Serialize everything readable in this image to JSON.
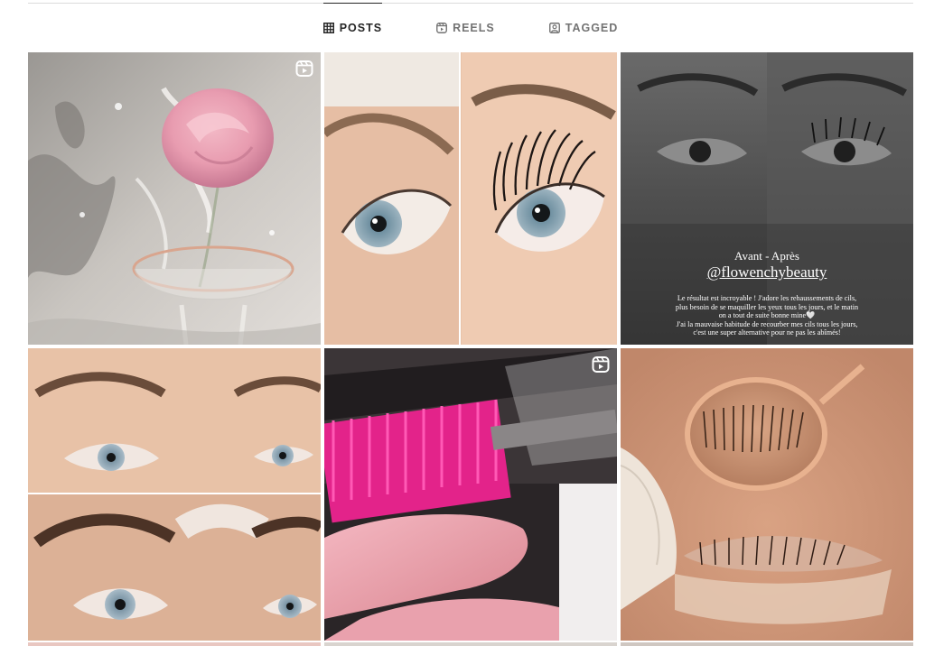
{
  "tabs": [
    {
      "label": "POSTS",
      "icon": "grid-icon",
      "active": true
    },
    {
      "label": "REELS",
      "icon": "reels-icon",
      "active": false
    },
    {
      "label": "TAGGED",
      "icon": "tagged-icon",
      "active": false
    }
  ],
  "posts": [
    {
      "subject": "pink rose and champagne glass splash",
      "is_reel": true
    },
    {
      "subject": "lash lift before and after close-up",
      "is_reel": false
    },
    {
      "subject": "black and white before after eyes",
      "is_reel": false,
      "overlay": {
        "title": "Avant - Après",
        "handle": "@flowenchybeauty",
        "lines": [
          "Le résultat est incroyable ! J'adore les rehaussements de cils,",
          "plus besoin de se maquiller les yeux tous les jours, et le matin",
          "on a tout de suite bonne mine🤍",
          "J'ai la mauvaise habitude de recourber mes cils tous les jours,",
          "c'est une super alternative pour ne pas les abîmés!"
        ]
      }
    },
    {
      "subject": "brow lamination before after",
      "is_reel": false
    },
    {
      "subject": "pink mascara wand and silicone pads",
      "is_reel": true
    },
    {
      "subject": "lash lift with dental mirror",
      "is_reel": false
    }
  ],
  "colors": {
    "active_tab": "#262626",
    "inactive_tab": "#737373",
    "divider": "#dbdbdb"
  }
}
